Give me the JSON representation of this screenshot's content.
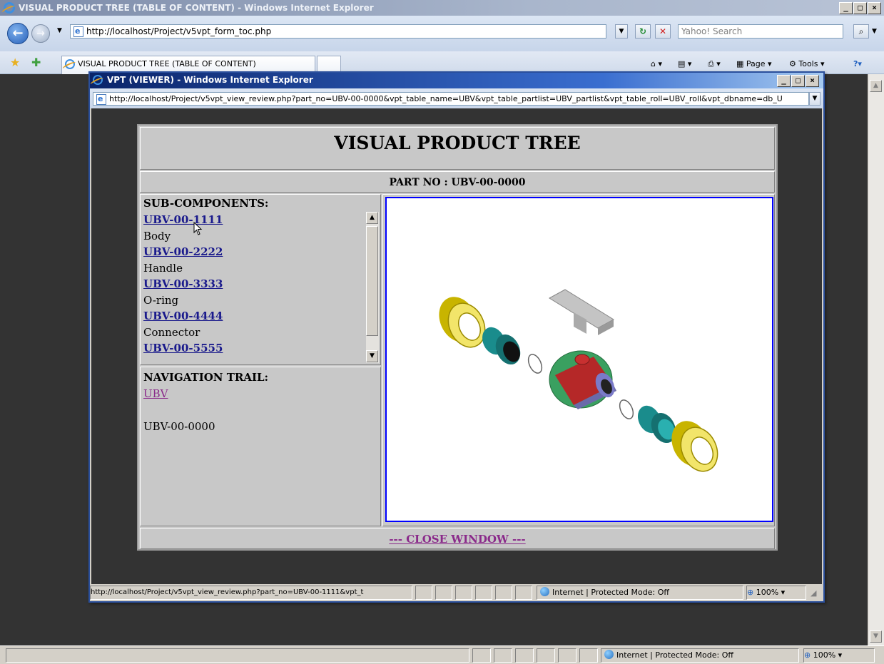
{
  "outer": {
    "title": "VISUAL PRODUCT TREE (TABLE OF CONTENT) - Windows Internet Explorer",
    "address": "http://localhost/Project/v5vpt_form_toc.php",
    "search_placeholder": "Yahoo! Search",
    "tab_label": "VISUAL PRODUCT TREE (TABLE OF CONTENT)",
    "toolbar": {
      "page_label": "Page",
      "tools_label": "Tools"
    },
    "status": {
      "zone": "Internet | Protected Mode: Off",
      "zoom": "100%"
    }
  },
  "popup": {
    "title": "VPT (VIEWER) - Windows Internet Explorer",
    "address": "http://localhost/Project/v5vpt_view_review.php?part_no=UBV-00-0000&vpt_table_name=UBV&vpt_table_partlist=UBV_partlist&vpt_table_roll=UBV_roll&vpt_dbname=db_U",
    "status_url": "http://localhost/Project/v5vpt_view_review.php?part_no=UBV-00-1111&vpt_t",
    "status_zone": "Internet | Protected Mode: Off",
    "status_zoom": "100%"
  },
  "vpt": {
    "title": "VISUAL PRODUCT TREE",
    "part_no": "PART NO : UBV-00-0000",
    "sub_heading": "SUB-COMPONENTS:",
    "components": [
      {
        "part": "UBV-00-1111",
        "desc": "Body"
      },
      {
        "part": "UBV-00-2222",
        "desc": "Handle"
      },
      {
        "part": "UBV-00-3333",
        "desc": "O-ring"
      },
      {
        "part": "UBV-00-4444",
        "desc": "Connector"
      },
      {
        "part": "UBV-00-5555",
        "desc": ""
      }
    ],
    "nav_heading": "NAVIGATION TRAIL:",
    "trail_link": "UBV",
    "trail_current": "UBV-00-0000",
    "close_label": "--- CLOSE WINDOW ---"
  },
  "icons": {
    "back": "back-arrow-icon",
    "forward": "forward-arrow-icon",
    "refresh": "refresh-icon",
    "stop": "stop-icon",
    "search": "search-icon",
    "favorites": "favorites-star-icon",
    "home": "home-icon",
    "feeds": "feeds-icon",
    "print": "print-icon",
    "help": "help-icon"
  },
  "colors": {
    "page_background": "#333333",
    "panel": "#c8c8c8",
    "link": "#1a1a8c",
    "visited_link": "#8a2a8a",
    "viewer_border": "#0000ff"
  }
}
